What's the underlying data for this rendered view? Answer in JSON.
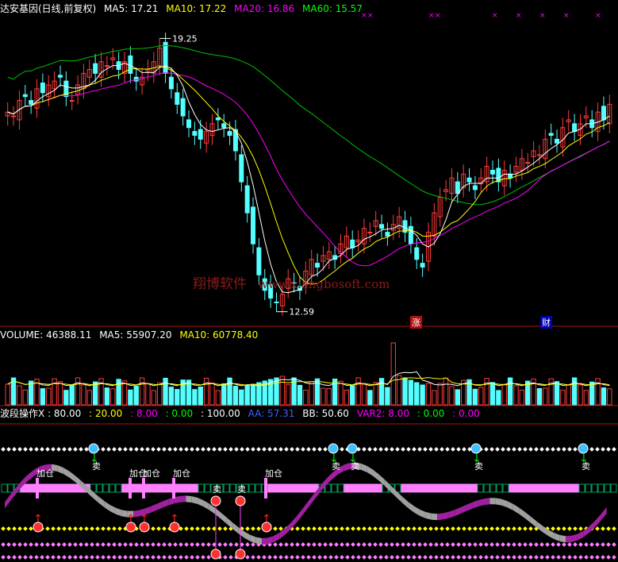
{
  "price_panel": {
    "title": "达安基因(日线,前复权)",
    "ma5": "MA5: 17.21",
    "ma10": "MA10: 17.22",
    "ma20": "MA20: 16.86",
    "ma60": "MA60: 15.57",
    "high_label": "19.25",
    "low_label": "12.59",
    "markers": [
      "涨",
      "财"
    ]
  },
  "watermark": {
    "cn": "翔博软件",
    "url": "www.xiangbosoft.com"
  },
  "volume_panel": {
    "volume": "VOLUME: 46388.11",
    "ma5": "MA5: 55907.20",
    "ma10": "MA10: 60778.40"
  },
  "indicator_panel": {
    "name": "波段操作X",
    "params": [
      ": 80.00",
      ": 20.00",
      ": 8.00",
      ": 0.00",
      ": 100.00"
    ],
    "aa": "AA: 57.31",
    "bb": "BB: 50.60",
    "var2": "VAR2: 8.00",
    "var2b": ": 0.00",
    "var2c": ": 0.00",
    "signals": {
      "add": [
        "加仓",
        "加仓",
        "加仓",
        "加仓",
        "加仓"
      ],
      "sell": [
        "卖",
        "卖",
        "卖",
        "卖",
        "卖",
        "卖"
      ],
      "mid_sell": [
        "卖",
        "卖"
      ]
    }
  },
  "colors": {
    "up": "#ff3b3b",
    "down": "#54ffff",
    "ma5": "#ffffff",
    "ma10": "#ffff00",
    "ma20": "#ff00ff",
    "ma60": "#00c000",
    "axis": "#b01010",
    "purple": "#a020a0",
    "gray": "#a0a0a0",
    "pink": "#ff80ff"
  },
  "chart_data": [
    {
      "type": "candlestick",
      "title": "达安基因(日线,前复权)",
      "series": [
        {
          "name": "MA5",
          "last": 17.21
        },
        {
          "name": "MA10",
          "last": 17.22
        },
        {
          "name": "MA20",
          "last": 16.86
        },
        {
          "name": "MA60",
          "last": 15.57
        }
      ],
      "annotations": [
        {
          "text": "19.25",
          "kind": "high"
        },
        {
          "text": "12.59",
          "kind": "low"
        }
      ],
      "ylim": [
        12.3,
        20.0
      ],
      "close": [
        17.6,
        17.5,
        17.9,
        18.0,
        17.8,
        18.2,
        18.1,
        18.3,
        18.4,
        18.5,
        18.0,
        17.9,
        18.3,
        18.6,
        18.7,
        18.6,
        18.9,
        18.8,
        19.0,
        18.7,
        18.9,
        18.6,
        18.4,
        18.5,
        18.7,
        18.9,
        19.25,
        18.6,
        18.2,
        17.8,
        17.5,
        17.2,
        17.0,
        16.9,
        17.1,
        17.3,
        17.4,
        17.2,
        17.0,
        16.6,
        15.8,
        15.0,
        14.2,
        13.4,
        13.0,
        12.8,
        12.7,
        12.9,
        13.3,
        13.2,
        13.0,
        13.5,
        13.8,
        13.6,
        13.9,
        14.0,
        13.8,
        14.2,
        14.4,
        14.1,
        14.3,
        14.6,
        14.5,
        14.8,
        14.6,
        14.4,
        14.7,
        14.9,
        14.5,
        14.2,
        13.8,
        13.6,
        14.5,
        15.0,
        15.4,
        15.6,
        15.9,
        15.5,
        16.0,
        15.8,
        15.6,
        15.9,
        16.2,
        16.0,
        15.8,
        16.1,
        15.9,
        16.2,
        16.4,
        16.3,
        16.6,
        16.5,
        16.9,
        17.0,
        16.8,
        17.2,
        17.4,
        17.1,
        17.3,
        17.5,
        17.2,
        17.6,
        17.4,
        17.8
      ]
    },
    {
      "type": "bar",
      "title": "VOLUME",
      "series": [
        {
          "name": "VOLUME",
          "last": 46388.11
        },
        {
          "name": "MA5",
          "last": 55907.2
        },
        {
          "name": "MA10",
          "last": 60778.4
        }
      ]
    },
    {
      "type": "line",
      "title": "波段操作X",
      "series": [
        {
          "name": "AA",
          "last": 57.31
        },
        {
          "name": "BB",
          "last": 50.6
        },
        {
          "name": "VAR2",
          "last": 8.0
        }
      ],
      "levels": [
        80.0,
        20.0,
        8.0,
        0.0,
        100.0
      ]
    }
  ]
}
